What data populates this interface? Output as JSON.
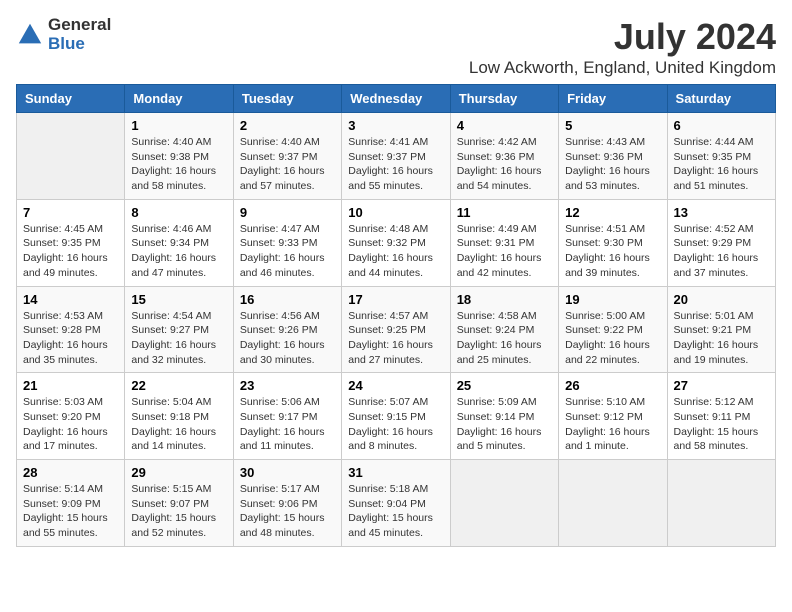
{
  "logo": {
    "general": "General",
    "blue": "Blue"
  },
  "title": "July 2024",
  "subtitle": "Low Ackworth, England, United Kingdom",
  "days_header": [
    "Sunday",
    "Monday",
    "Tuesday",
    "Wednesday",
    "Thursday",
    "Friday",
    "Saturday"
  ],
  "weeks": [
    [
      {
        "day": "",
        "info": ""
      },
      {
        "day": "1",
        "info": "Sunrise: 4:40 AM\nSunset: 9:38 PM\nDaylight: 16 hours\nand 58 minutes."
      },
      {
        "day": "2",
        "info": "Sunrise: 4:40 AM\nSunset: 9:37 PM\nDaylight: 16 hours\nand 57 minutes."
      },
      {
        "day": "3",
        "info": "Sunrise: 4:41 AM\nSunset: 9:37 PM\nDaylight: 16 hours\nand 55 minutes."
      },
      {
        "day": "4",
        "info": "Sunrise: 4:42 AM\nSunset: 9:36 PM\nDaylight: 16 hours\nand 54 minutes."
      },
      {
        "day": "5",
        "info": "Sunrise: 4:43 AM\nSunset: 9:36 PM\nDaylight: 16 hours\nand 53 minutes."
      },
      {
        "day": "6",
        "info": "Sunrise: 4:44 AM\nSunset: 9:35 PM\nDaylight: 16 hours\nand 51 minutes."
      }
    ],
    [
      {
        "day": "7",
        "info": "Sunrise: 4:45 AM\nSunset: 9:35 PM\nDaylight: 16 hours\nand 49 minutes."
      },
      {
        "day": "8",
        "info": "Sunrise: 4:46 AM\nSunset: 9:34 PM\nDaylight: 16 hours\nand 47 minutes."
      },
      {
        "day": "9",
        "info": "Sunrise: 4:47 AM\nSunset: 9:33 PM\nDaylight: 16 hours\nand 46 minutes."
      },
      {
        "day": "10",
        "info": "Sunrise: 4:48 AM\nSunset: 9:32 PM\nDaylight: 16 hours\nand 44 minutes."
      },
      {
        "day": "11",
        "info": "Sunrise: 4:49 AM\nSunset: 9:31 PM\nDaylight: 16 hours\nand 42 minutes."
      },
      {
        "day": "12",
        "info": "Sunrise: 4:51 AM\nSunset: 9:30 PM\nDaylight: 16 hours\nand 39 minutes."
      },
      {
        "day": "13",
        "info": "Sunrise: 4:52 AM\nSunset: 9:29 PM\nDaylight: 16 hours\nand 37 minutes."
      }
    ],
    [
      {
        "day": "14",
        "info": "Sunrise: 4:53 AM\nSunset: 9:28 PM\nDaylight: 16 hours\nand 35 minutes."
      },
      {
        "day": "15",
        "info": "Sunrise: 4:54 AM\nSunset: 9:27 PM\nDaylight: 16 hours\nand 32 minutes."
      },
      {
        "day": "16",
        "info": "Sunrise: 4:56 AM\nSunset: 9:26 PM\nDaylight: 16 hours\nand 30 minutes."
      },
      {
        "day": "17",
        "info": "Sunrise: 4:57 AM\nSunset: 9:25 PM\nDaylight: 16 hours\nand 27 minutes."
      },
      {
        "day": "18",
        "info": "Sunrise: 4:58 AM\nSunset: 9:24 PM\nDaylight: 16 hours\nand 25 minutes."
      },
      {
        "day": "19",
        "info": "Sunrise: 5:00 AM\nSunset: 9:22 PM\nDaylight: 16 hours\nand 22 minutes."
      },
      {
        "day": "20",
        "info": "Sunrise: 5:01 AM\nSunset: 9:21 PM\nDaylight: 16 hours\nand 19 minutes."
      }
    ],
    [
      {
        "day": "21",
        "info": "Sunrise: 5:03 AM\nSunset: 9:20 PM\nDaylight: 16 hours\nand 17 minutes."
      },
      {
        "day": "22",
        "info": "Sunrise: 5:04 AM\nSunset: 9:18 PM\nDaylight: 16 hours\nand 14 minutes."
      },
      {
        "day": "23",
        "info": "Sunrise: 5:06 AM\nSunset: 9:17 PM\nDaylight: 16 hours\nand 11 minutes."
      },
      {
        "day": "24",
        "info": "Sunrise: 5:07 AM\nSunset: 9:15 PM\nDaylight: 16 hours\nand 8 minutes."
      },
      {
        "day": "25",
        "info": "Sunrise: 5:09 AM\nSunset: 9:14 PM\nDaylight: 16 hours\nand 5 minutes."
      },
      {
        "day": "26",
        "info": "Sunrise: 5:10 AM\nSunset: 9:12 PM\nDaylight: 16 hours\nand 1 minute."
      },
      {
        "day": "27",
        "info": "Sunrise: 5:12 AM\nSunset: 9:11 PM\nDaylight: 15 hours\nand 58 minutes."
      }
    ],
    [
      {
        "day": "28",
        "info": "Sunrise: 5:14 AM\nSunset: 9:09 PM\nDaylight: 15 hours\nand 55 minutes."
      },
      {
        "day": "29",
        "info": "Sunrise: 5:15 AM\nSunset: 9:07 PM\nDaylight: 15 hours\nand 52 minutes."
      },
      {
        "day": "30",
        "info": "Sunrise: 5:17 AM\nSunset: 9:06 PM\nDaylight: 15 hours\nand 48 minutes."
      },
      {
        "day": "31",
        "info": "Sunrise: 5:18 AM\nSunset: 9:04 PM\nDaylight: 15 hours\nand 45 minutes."
      },
      {
        "day": "",
        "info": ""
      },
      {
        "day": "",
        "info": ""
      },
      {
        "day": "",
        "info": ""
      }
    ]
  ]
}
